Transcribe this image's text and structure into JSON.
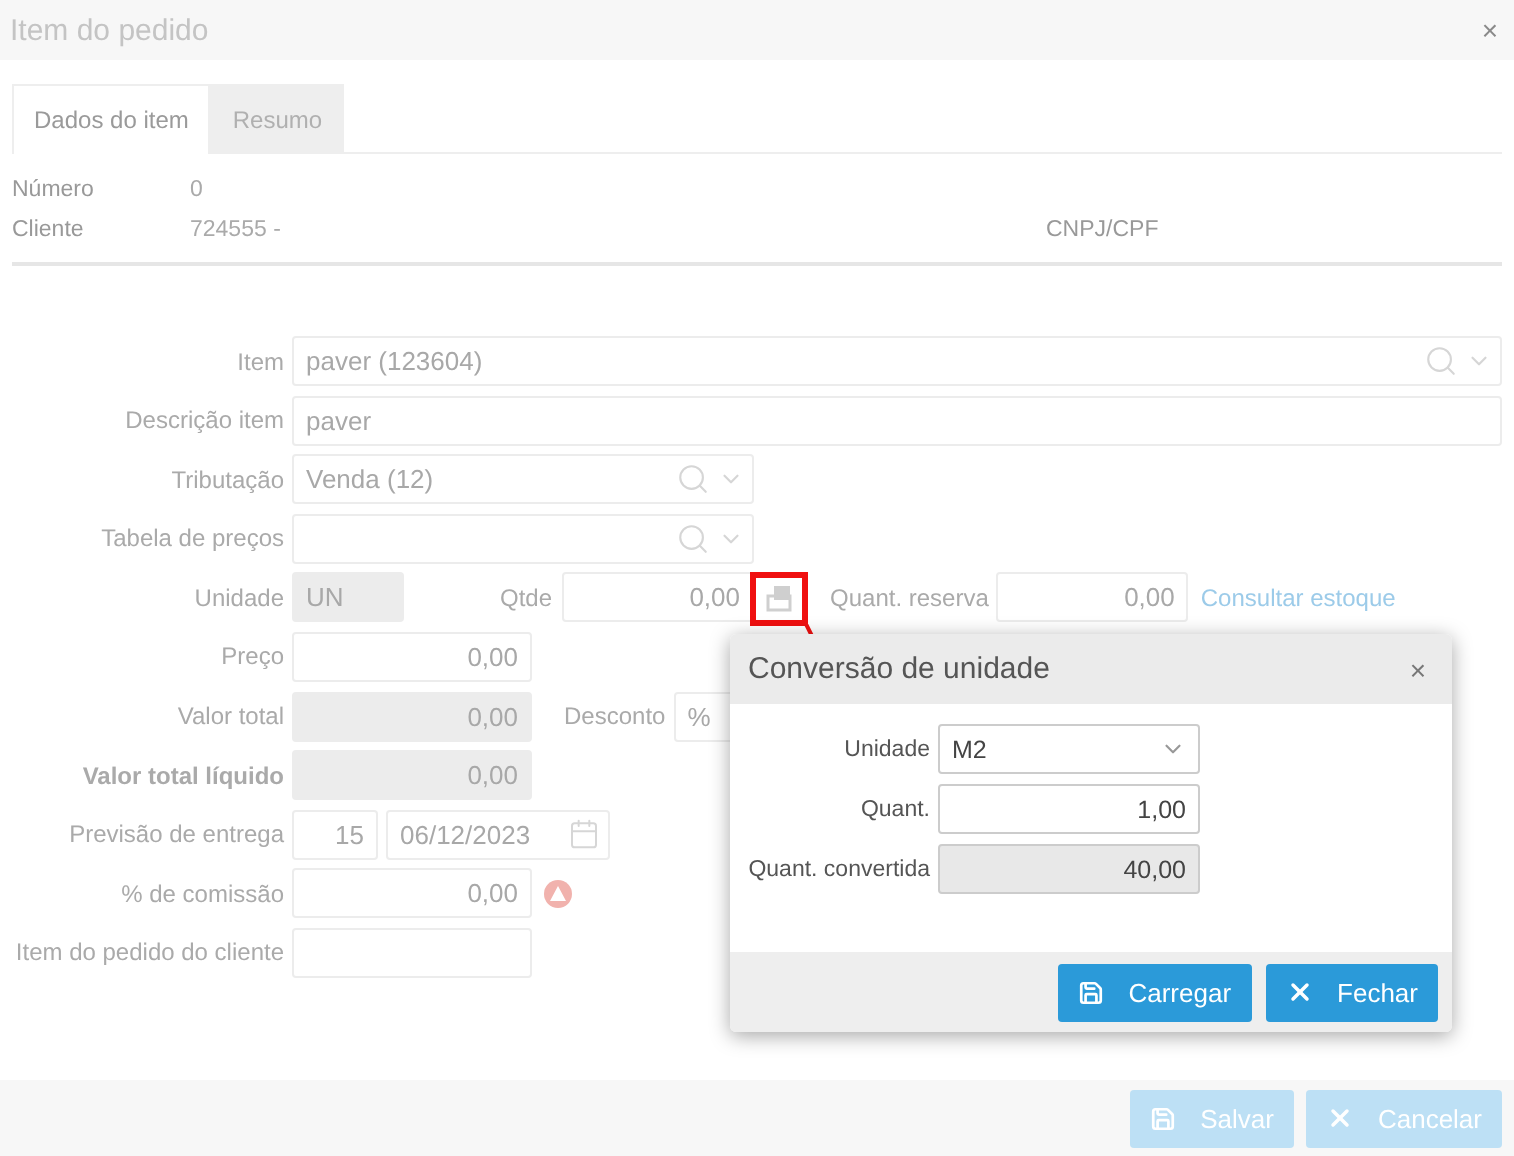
{
  "dialog": {
    "title": "Item do pedido",
    "close": "×"
  },
  "tabs": [
    {
      "label": "Dados do item",
      "selected": true
    },
    {
      "label": "Resumo",
      "selected": false
    }
  ],
  "info": [
    {
      "label": "Número",
      "value": "0"
    },
    {
      "label": "Cliente",
      "value": "724555 -"
    }
  ],
  "cnpj_label": "CNPJ/CPF",
  "form": {
    "item": {
      "label": "Item",
      "value": "paver (123604)"
    },
    "description": {
      "label": "Descrição item",
      "value": "paver"
    },
    "taxation": {
      "label": "Tributação",
      "value": "Venda (12)"
    },
    "price_table": {
      "label": "Tabela de preços"
    },
    "unit": {
      "label": "Unidade",
      "value": "UN",
      "disabled": true
    },
    "qty": {
      "label": "Qtde",
      "value": "0,00"
    },
    "reserve": {
      "label": "Quant. reserva",
      "value": "0,00"
    },
    "stock_link": "Consultar estoque",
    "price": {
      "label": "Preço",
      "value": "0,00",
      "disabled": false
    },
    "total": {
      "label": "Valor total",
      "value": "0,00",
      "disabled": true
    },
    "discount": {
      "label": "Desconto",
      "value": "%"
    },
    "net_total": {
      "label": "Valor total líquido",
      "value": "0,00",
      "disabled": true
    },
    "delivery": {
      "label": "Previsão de entrega",
      "days": "15",
      "date": "06/12/2023"
    },
    "commission": {
      "label": "% de comissão",
      "value": "0,00"
    },
    "customer_item": {
      "label": "Item do pedido do cliente"
    }
  },
  "footer": {
    "buttons": [
      {
        "label": "Salvar",
        "kind": "save"
      },
      {
        "label": "Cancelar",
        "kind": "cancel"
      }
    ]
  },
  "popup": {
    "title": "Conversão de unidade",
    "close": "×",
    "unit": {
      "label": "Unidade",
      "value": "M2"
    },
    "qty": {
      "label": "Quant.",
      "value": "1,00",
      "disabled": false
    },
    "converted": {
      "label": "Quant. convertida",
      "value": "40,00",
      "disabled": true
    },
    "buttons": [
      {
        "label": "Carregar",
        "kind": "load"
      },
      {
        "label": "Fechar",
        "kind": "close"
      }
    ]
  }
}
